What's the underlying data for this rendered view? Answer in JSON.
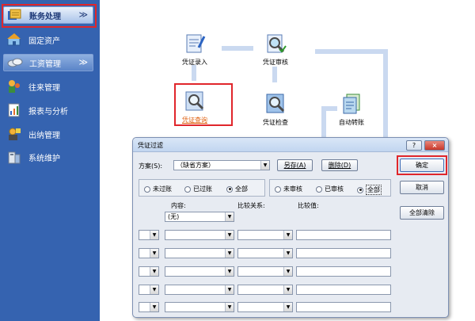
{
  "sidebar": {
    "items": [
      {
        "label": "账务处理",
        "chevron": "≫",
        "icon": "ledger-icon"
      },
      {
        "label": "固定资产",
        "icon": "fixed-asset-icon"
      },
      {
        "label": "工资管理",
        "chevron": "≫",
        "icon": "payroll-icon"
      },
      {
        "label": "往来管理",
        "icon": "accounts-icon"
      },
      {
        "label": "报表与分析",
        "icon": "report-icon"
      },
      {
        "label": "出纳管理",
        "icon": "cashier-icon"
      },
      {
        "label": "系统维护",
        "icon": "maintenance-icon"
      }
    ]
  },
  "flow": {
    "nodes": [
      {
        "label": "凭证录入",
        "icon": "voucher-entry-icon"
      },
      {
        "label": "凭证审核",
        "icon": "voucher-audit-icon"
      },
      {
        "label": "凭证查询",
        "icon": "voucher-query-icon"
      },
      {
        "label": "凭证检查",
        "icon": "voucher-check-icon"
      },
      {
        "label": "自动转账",
        "icon": "auto-transfer-icon"
      }
    ]
  },
  "dialog": {
    "title": "凭证过滤",
    "help": "?",
    "close": "×",
    "scheme_label": "方案(S):",
    "scheme_value": "（缺省方案）",
    "save_as": "另存(A)",
    "delete": "删除(D)",
    "ok": "确定",
    "cancel": "取消",
    "clear_all": "全部清除",
    "posting": {
      "options": [
        "未过账",
        "已过账",
        "全部"
      ],
      "selected": "全部"
    },
    "audit": {
      "options": [
        "未审核",
        "已审核",
        "全部"
      ],
      "selected": "全部"
    },
    "headers": {
      "content": "内容:",
      "relation": "比较关系:",
      "value": "比较值:"
    },
    "first_row_content": "(无)"
  },
  "colors": {
    "sidebar_bg": "#3563b0",
    "highlight": "#e0262b",
    "link": "#e06010"
  }
}
